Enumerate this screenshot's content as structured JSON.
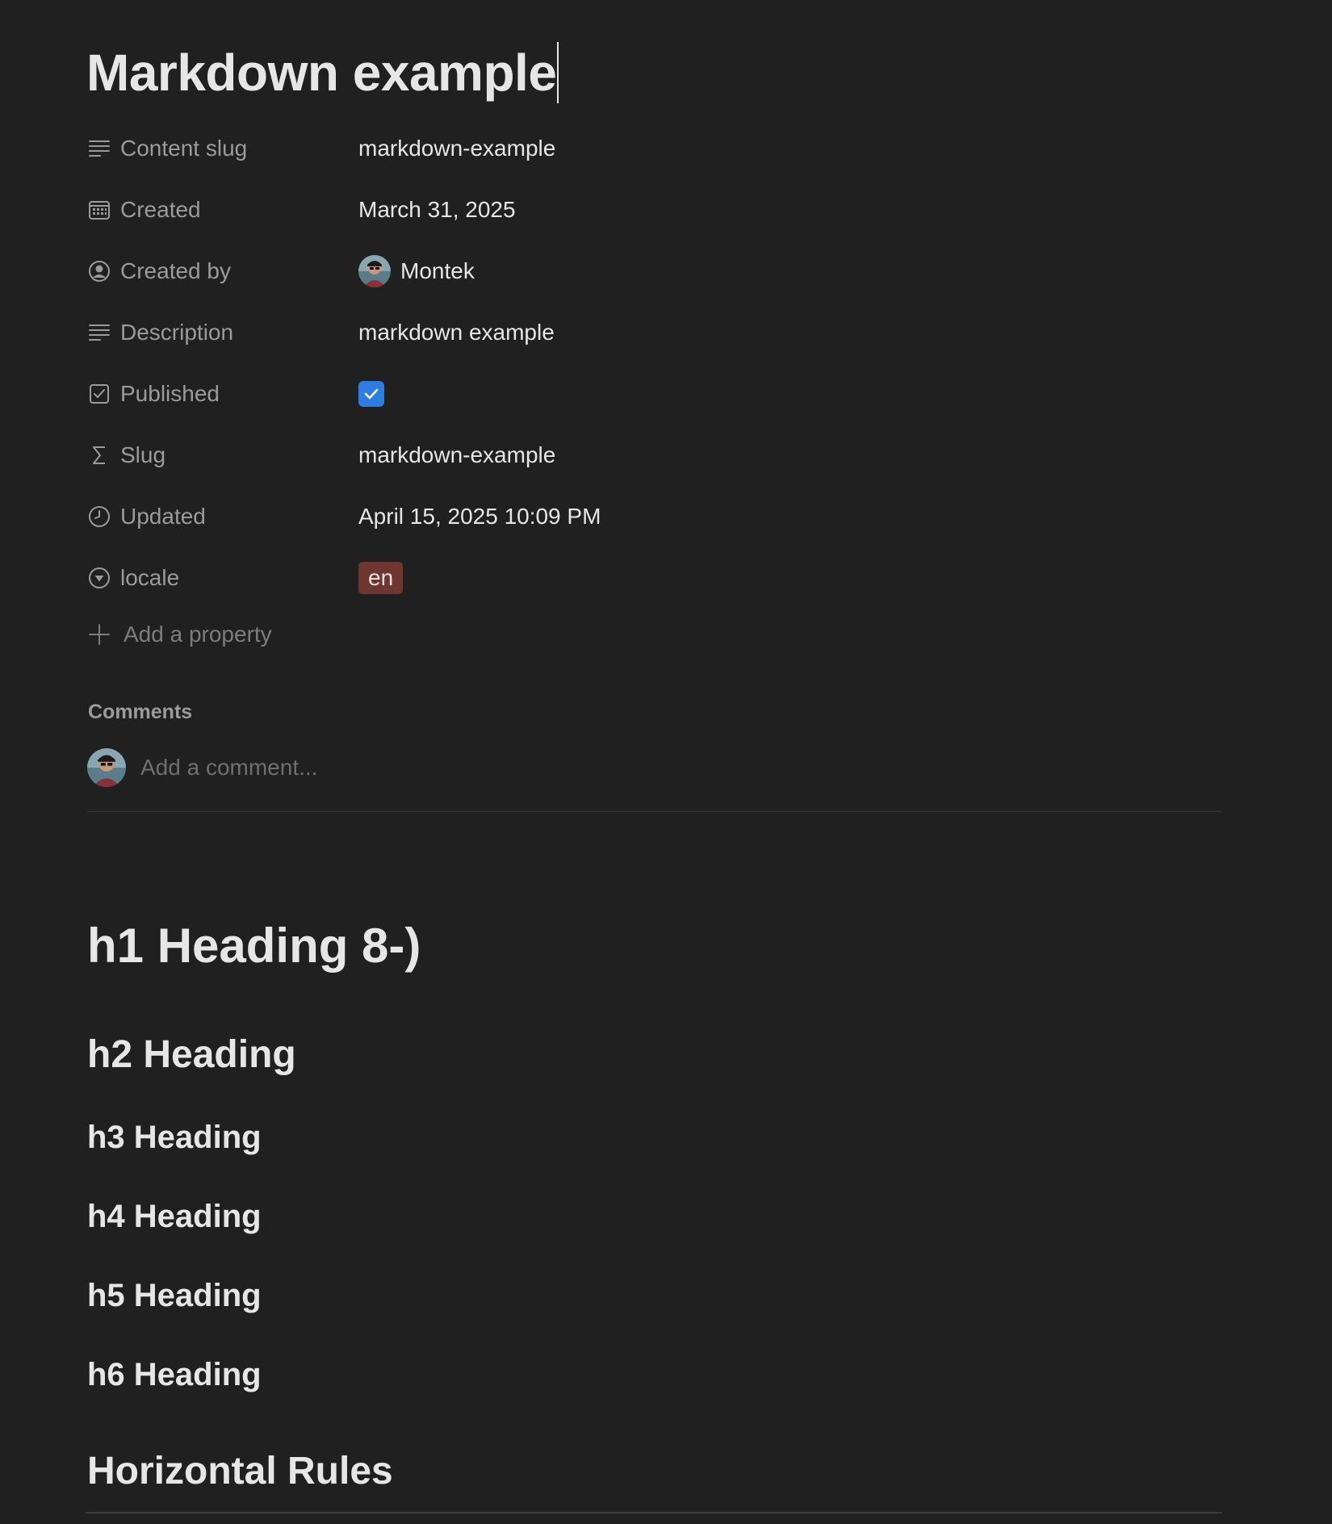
{
  "page": {
    "title": "Markdown example"
  },
  "properties": [
    {
      "key": "content_slug",
      "label": "Content slug",
      "icon": "text-lines-icon",
      "type": "text",
      "value": "markdown-example"
    },
    {
      "key": "created",
      "label": "Created",
      "icon": "calendar-icon",
      "type": "text",
      "value": "March 31, 2025"
    },
    {
      "key": "created_by",
      "label": "Created by",
      "icon": "person-circle-icon",
      "type": "person",
      "value": "Montek"
    },
    {
      "key": "description",
      "label": "Description",
      "icon": "text-lines-icon",
      "type": "text",
      "value": "markdown example"
    },
    {
      "key": "published",
      "label": "Published",
      "icon": "checkbox-icon",
      "type": "checkbox",
      "checked": true
    },
    {
      "key": "slug",
      "label": "Slug",
      "icon": "sigma-icon",
      "type": "text",
      "value": "markdown-example"
    },
    {
      "key": "updated",
      "label": "Updated",
      "icon": "clock-icon",
      "type": "text",
      "value": "April 15, 2025 10:09 PM"
    },
    {
      "key": "locale",
      "label": "locale",
      "icon": "select-icon",
      "type": "select",
      "value": "en"
    }
  ],
  "add_property": {
    "label": "Add a property"
  },
  "comments": {
    "heading": "Comments",
    "placeholder": "Add a comment..."
  },
  "content": {
    "h1": "h1 Heading 8-)",
    "h2": "h2 Heading",
    "h3": "h3 Heading",
    "h4": "h4 Heading",
    "h5": "h5 Heading",
    "h6": "h6 Heading",
    "horizontal_rules": "Horizontal Rules"
  },
  "colors": {
    "background": "#202020",
    "checkbox_checked": "#2f7de1",
    "locale_tag_bg": "#6e3630",
    "muted_text": "#9b9b9b",
    "primary_text": "#e6e6e6"
  }
}
